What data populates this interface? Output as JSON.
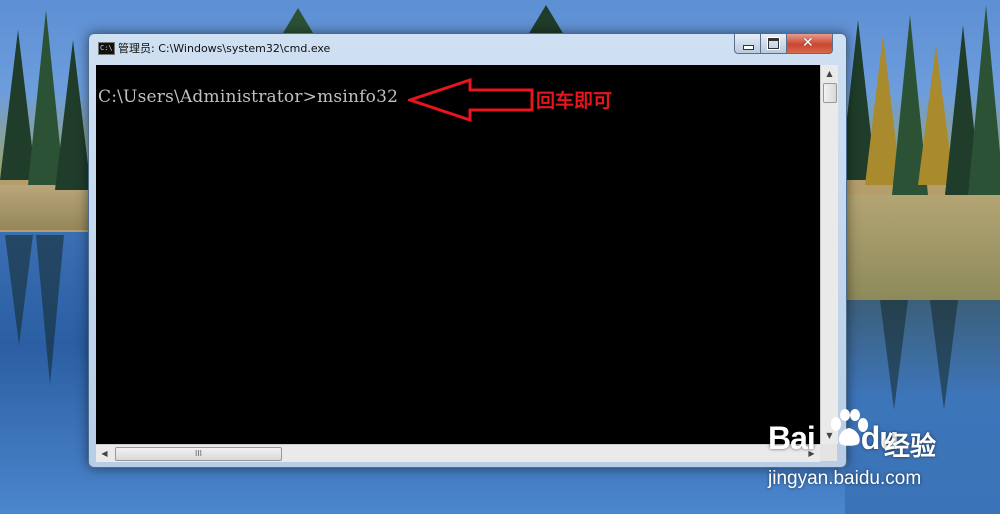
{
  "window": {
    "title": "管理员: C:\\Windows\\system32\\cmd.exe",
    "icon_label": "C:\\"
  },
  "console": {
    "prompt_line": "C:\\Users\\Administrator>msinfo32"
  },
  "annotation": {
    "text": "回车即可",
    "color": "#e8141e"
  },
  "watermark": {
    "logo_text": "Bai",
    "logo_suffix": "du",
    "brand": "经验",
    "url": "jingyan.baidu.com"
  },
  "scrollbar": {
    "up_arrow": "▲",
    "down_arrow": "▼",
    "left_arrow": "◀",
    "right_arrow": "▶",
    "grip": "III"
  },
  "icons": [
    "cmd-icon",
    "minimize-icon",
    "maximize-icon",
    "close-icon",
    "red-arrow-icon",
    "baidu-paw-icon"
  ]
}
